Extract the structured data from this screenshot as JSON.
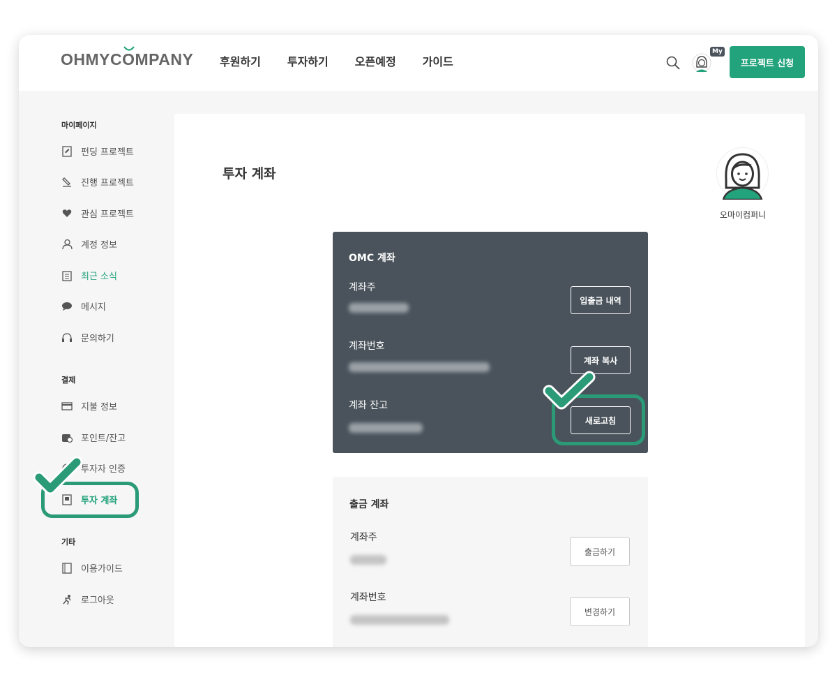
{
  "header": {
    "logo": "OHMYCOMPANY",
    "nav": [
      "후원하기",
      "투자하기",
      "오픈예정",
      "가이드"
    ],
    "my_badge": "My",
    "cta_label": "프로젝트 신청"
  },
  "sidebar": {
    "groups": [
      {
        "title": "마이페이지",
        "items": [
          {
            "label": "펀딩 프로젝트",
            "icon": "edit-document-icon"
          },
          {
            "label": "진행 프로젝트",
            "icon": "pen-icon"
          },
          {
            "label": "관심 프로젝트",
            "icon": "heart-icon"
          },
          {
            "label": "계정 정보",
            "icon": "user-icon"
          },
          {
            "label": "최근 소식",
            "icon": "notepad-icon"
          },
          {
            "label": "메시지",
            "icon": "chat-icon"
          },
          {
            "label": "문의하기",
            "icon": "headset-icon"
          }
        ]
      },
      {
        "title": "결제",
        "items": [
          {
            "label": "지불 정보",
            "icon": "card-icon"
          },
          {
            "label": "포인트/잔고",
            "icon": "wallet-icon"
          },
          {
            "label": "투자자 인증",
            "icon": "badge-icon"
          },
          {
            "label": "투자 계좌",
            "icon": "bankbook-icon"
          }
        ]
      },
      {
        "title": "기타",
        "items": [
          {
            "label": "이용가이드",
            "icon": "book-icon"
          },
          {
            "label": "로그아웃",
            "icon": "runner-icon"
          }
        ]
      }
    ]
  },
  "main": {
    "title": "투자 계좌",
    "profile_name": "오마이컴퍼니",
    "omc_account": {
      "title": "OMC 계좌",
      "owner_label": "계좌주",
      "number_label": "계좌번호",
      "balance_label": "계좌 잔고",
      "history_button": "입출금 내역",
      "copy_button": "계좌 복사",
      "refresh_button": "새로고침"
    },
    "withdraw_account": {
      "title": "출금 계좌",
      "owner_label": "계좌주",
      "number_label": "계좌번호",
      "withdraw_button": "출금하기",
      "change_button": "변경하기"
    }
  },
  "colors": {
    "brand": "#22a37b",
    "card_dark": "#4a535b",
    "annotation": "#2a9a77"
  }
}
